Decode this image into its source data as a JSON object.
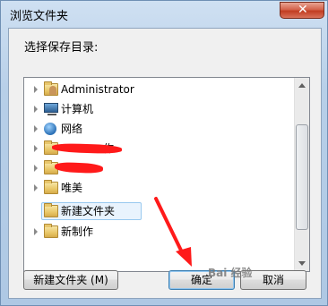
{
  "window": {
    "title": "浏览文件夹",
    "close_glyph": "✕"
  },
  "dialog": {
    "prompt": "选择保存目录:"
  },
  "tree": {
    "items": [
      {
        "label": "Administrator",
        "icon": "user-folder-icon"
      },
      {
        "label": "计算机",
        "icon": "computer-icon"
      },
      {
        "label": "网络",
        "icon": "network-icon"
      },
      {
        "label": "作",
        "icon": "folder-icon",
        "redacted": true
      },
      {
        "label": "",
        "icon": "folder-icon",
        "redacted": true
      },
      {
        "label": "唯美",
        "icon": "folder-icon"
      },
      {
        "label": "新建文件夹",
        "icon": "folder-icon",
        "selected": true
      },
      {
        "label": "新制作",
        "icon": "folder-icon"
      }
    ]
  },
  "buttons": {
    "new_folder": "新建文件夹 (M)",
    "ok": "确定",
    "cancel": "取消"
  },
  "colors": {
    "accent": "#3c7fb1",
    "annotation": "#ff1a1a"
  }
}
